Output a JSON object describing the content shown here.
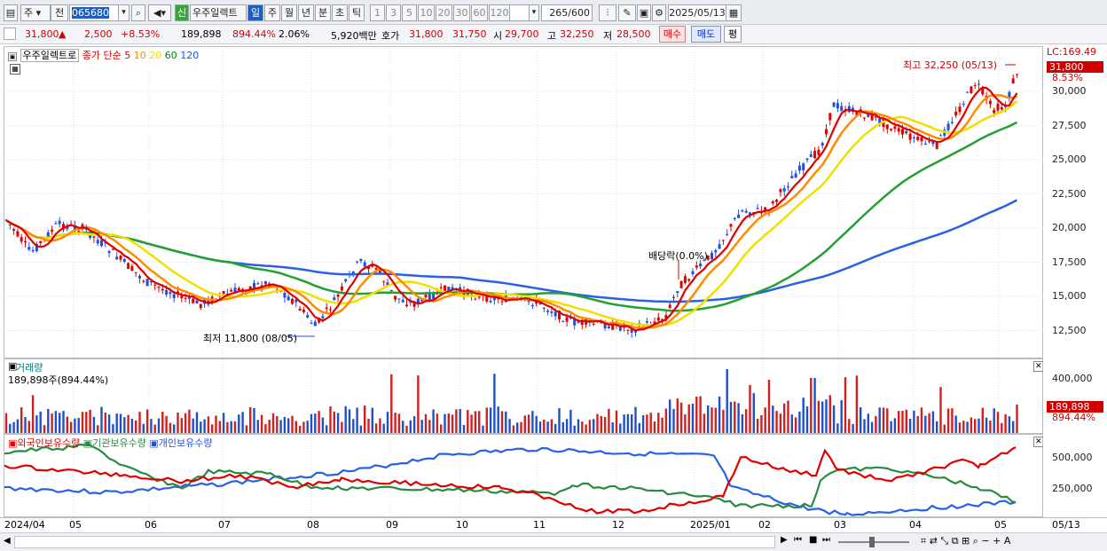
{
  "toolbar": {
    "market": "주",
    "prev_label": "전",
    "code": "065680",
    "name_badge": "신",
    "stock_name": "우주일렉트",
    "periods": [
      "일",
      "주",
      "월",
      "년",
      "분",
      "초",
      "틱"
    ],
    "intervals": [
      "1",
      "3",
      "5",
      "10",
      "20",
      "30",
      "60",
      "120"
    ],
    "count": "265",
    "count_max": "/600",
    "date": "2025/05/13"
  },
  "quote": {
    "price": "31,800",
    "change_arrow": "▲",
    "change": "2,500",
    "change_pct": "+8.53%",
    "volume": "189,898",
    "volume_pct": "894.44%",
    "turnover": "2.06%",
    "amount": "5,920백만",
    "hoga_label": "호가",
    "ask": "31,800",
    "bid": "31,750",
    "open_label": "시",
    "open": "29,700",
    "high_label": "고",
    "high": "32,250",
    "low_label": "저",
    "low": "28,500",
    "buy": "매수",
    "sell": "매도",
    "eval": "평"
  },
  "price_panel": {
    "title": "우주일렉트로",
    "ma_label": "종가 단순",
    "ma_periods": [
      {
        "p": "5",
        "color": "#e00000"
      },
      {
        "p": "10",
        "color": "#ff8c00"
      },
      {
        "p": "20",
        "color": "#e8d800"
      },
      {
        "p": "60",
        "color": "#008000"
      },
      {
        "p": "120",
        "color": "#1e50e0"
      }
    ],
    "lc": "LC:169.49",
    "last_price": "31,800",
    "last_pct": "8.53%",
    "high_note": "최고 32,250 (05/13)",
    "low_note": "최저 11,800 (08/05)",
    "div_note": "배당락(0.0%)",
    "y_ticks": [
      "30,000",
      "27,500",
      "25,000",
      "22,500",
      "20,000",
      "17,500",
      "15,000",
      "12,500"
    ]
  },
  "volume_panel": {
    "title": "거래량",
    "sub": "189,898주(894.44%)",
    "y_ticks": [
      "400,000"
    ],
    "last": "189,898",
    "last_pct": "894.44%"
  },
  "holding_panel": {
    "legend": [
      {
        "name": "외국인보유수량",
        "color": "#e00000"
      },
      {
        "name": "기관보유수량",
        "color": "#2a8a40"
      },
      {
        "name": "개인보유수량",
        "color": "#1e50e0"
      }
    ],
    "y_ticks": [
      "500,000",
      "250,000"
    ]
  },
  "x_axis": [
    "2024/04",
    "05",
    "06",
    "07",
    "08",
    "09",
    "10",
    "11",
    "12",
    "2025/01",
    "02",
    "03",
    "04",
    "05"
  ],
  "x_axis_right": "05/13"
}
